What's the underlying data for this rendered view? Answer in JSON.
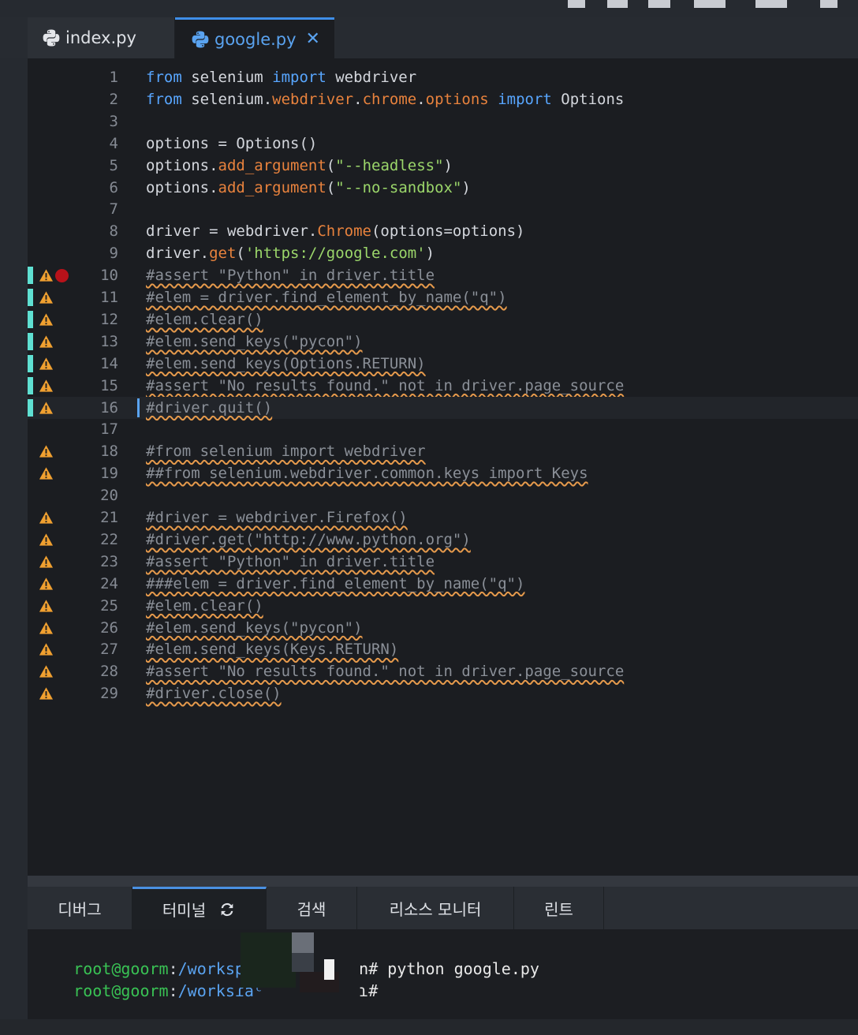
{
  "tabs": [
    {
      "label": "index.py",
      "active": false
    },
    {
      "label": "google.py",
      "active": true,
      "close": "✕"
    }
  ],
  "editor": {
    "lines": [
      {
        "n": "1",
        "tokens": [
          [
            "kw",
            "from"
          ],
          [
            "tx",
            " selenium "
          ],
          [
            "kw",
            "import"
          ],
          [
            "tx",
            " webdriver"
          ]
        ]
      },
      {
        "n": "2",
        "tokens": [
          [
            "kw",
            "from"
          ],
          [
            "tx",
            " selenium."
          ],
          [
            "fn",
            "webdriver"
          ],
          [
            "tx",
            "."
          ],
          [
            "fn",
            "chrome"
          ],
          [
            "tx",
            "."
          ],
          [
            "fn",
            "options"
          ],
          [
            "tx",
            " "
          ],
          [
            "kw",
            "import"
          ],
          [
            "tx",
            " Options"
          ]
        ]
      },
      {
        "n": "3",
        "tokens": []
      },
      {
        "n": "4",
        "tokens": [
          [
            "tx",
            "options = Options()"
          ]
        ]
      },
      {
        "n": "5",
        "tokens": [
          [
            "tx",
            "options."
          ],
          [
            "fn",
            "add_argument"
          ],
          [
            "tx",
            "("
          ],
          [
            "st",
            "\"--headless\""
          ],
          [
            "tx",
            ")"
          ]
        ]
      },
      {
        "n": "6",
        "tokens": [
          [
            "tx",
            "options."
          ],
          [
            "fn",
            "add_argument"
          ],
          [
            "tx",
            "("
          ],
          [
            "st",
            "\"--no-sandbox\""
          ],
          [
            "tx",
            ")"
          ]
        ]
      },
      {
        "n": "7",
        "tokens": []
      },
      {
        "n": "8",
        "tokens": [
          [
            "tx",
            "driver = webdriver."
          ],
          [
            "fn",
            "Chrome"
          ],
          [
            "tx",
            "(options=options)"
          ]
        ]
      },
      {
        "n": "9",
        "tokens": [
          [
            "tx",
            "driver."
          ],
          [
            "fn",
            "get"
          ],
          [
            "tx",
            "("
          ],
          [
            "st",
            "'https://google.com'"
          ],
          [
            "tx",
            ")"
          ]
        ]
      },
      {
        "n": "10",
        "comment": "#assert \"Python\" in driver.title",
        "warn": true,
        "mod": true,
        "breakpoint": true
      },
      {
        "n": "11",
        "comment": "#elem = driver.find_element_by_name(\"q\")",
        "warn": true,
        "mod": true
      },
      {
        "n": "12",
        "comment": "#elem.clear()",
        "warn": true,
        "mod": true
      },
      {
        "n": "13",
        "comment": "#elem.send_keys(\"pycon\")",
        "warn": true,
        "mod": true
      },
      {
        "n": "14",
        "comment": "#elem.send_keys(Options.RETURN)",
        "warn": true,
        "mod": true
      },
      {
        "n": "15",
        "comment": "#assert \"No results found.\" not in driver.page_source",
        "warn": true,
        "mod": true
      },
      {
        "n": "16",
        "comment": "#driver.quit()",
        "warn": true,
        "mod": true,
        "active": true
      },
      {
        "n": "17",
        "tokens": []
      },
      {
        "n": "18",
        "comment": "#from selenium import webdriver",
        "warn": true
      },
      {
        "n": "19",
        "comment": "##from selenium.webdriver.common.keys import Keys",
        "warn": true
      },
      {
        "n": "20",
        "tokens": []
      },
      {
        "n": "21",
        "comment": "#driver = webdriver.Firefox()",
        "warn": true
      },
      {
        "n": "22",
        "comment": "#driver.get(\"http://www.python.org\")",
        "warn": true
      },
      {
        "n": "23",
        "comment": "#assert \"Python\" in driver.title",
        "warn": true
      },
      {
        "n": "24",
        "comment": "###elem = driver.find_element_by_name(\"q\")",
        "warn": true
      },
      {
        "n": "25",
        "comment": "#elem.clear()",
        "warn": true
      },
      {
        "n": "26",
        "comment": "#elem.send_keys(\"pycon\")",
        "warn": true
      },
      {
        "n": "27",
        "comment": "#elem.send_keys(Keys.RETURN)",
        "warn": true
      },
      {
        "n": "28",
        "comment": "#assert \"No results found.\" not in driver.page_source",
        "warn": true
      },
      {
        "n": "29",
        "comment": "#driver.close()",
        "warn": true
      }
    ]
  },
  "panel": {
    "tabs": [
      {
        "label": "디버그",
        "active": false
      },
      {
        "label": "터미널",
        "active": true
      },
      {
        "label": "검색",
        "active": false
      },
      {
        "label": "리소스 모니터",
        "active": false
      },
      {
        "label": "린트",
        "active": false
      }
    ]
  },
  "terminal": {
    "lines": [
      {
        "user": "root@goorm",
        "colon": ":",
        "path": "/workspac",
        "tail": "n# python google.py"
      },
      {
        "user": "root@goorm",
        "colon": ":",
        "path": "/worksɾaᶜ",
        "tail": "ɿ#"
      }
    ]
  },
  "colors": {
    "keyword": "#58a6ff",
    "function": "#e8823d",
    "string": "#9bd66a",
    "comment": "#8a8f97",
    "warning": "#f0a030",
    "breakpoint": "#b8121a",
    "modified": "#5fe0d2",
    "terminal_user": "#39c254",
    "terminal_path": "#5aa3f0"
  },
  "icons": {
    "tab": "python-icon",
    "warning": "warning-triangle-icon",
    "breakpoint": "breakpoint-dot-icon",
    "panel_terminal": "refresh-icon"
  }
}
